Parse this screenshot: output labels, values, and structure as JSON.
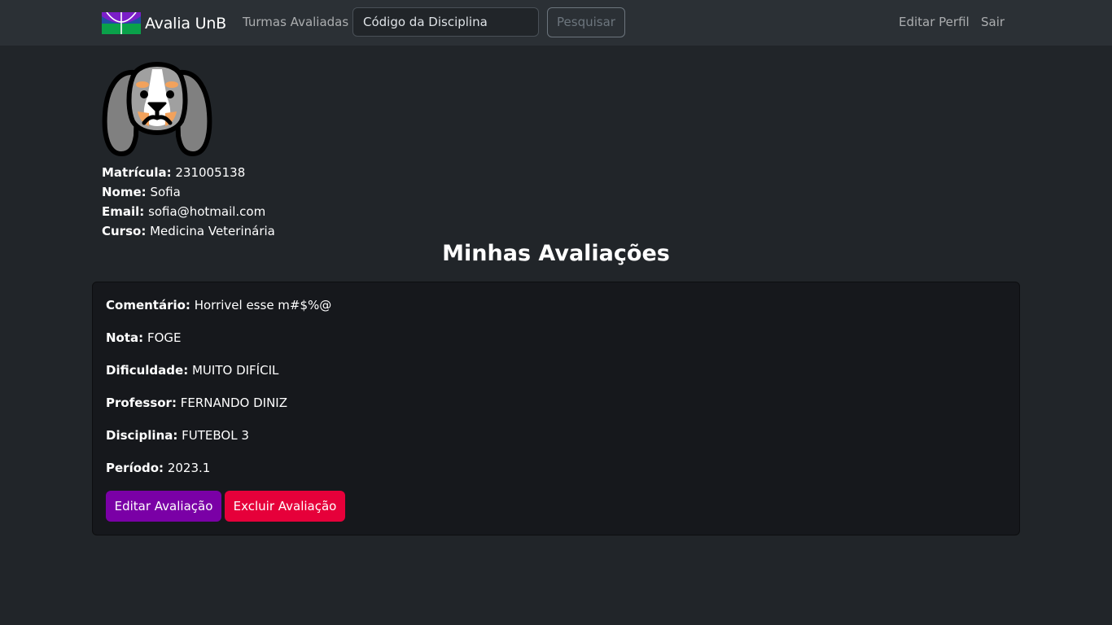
{
  "navbar": {
    "brand": "Avalia UnB",
    "turmas_link": "Turmas Avaliadas",
    "search_placeholder": "Código da Disciplina",
    "search_button": "Pesquisar",
    "edit_profile": "Editar Perfil",
    "logout": "Sair"
  },
  "profile": {
    "matricula_label": "Matrícula:",
    "matricula": "231005138",
    "nome_label": "Nome:",
    "nome": "Sofia",
    "email_label": "Email:",
    "email": "sofia@hotmail.com",
    "curso_label": "Curso:",
    "curso": "Medicina Veterinária"
  },
  "section_title": "Minhas Avaliações",
  "review": {
    "comentario_label": "Comentário:",
    "comentario": "Horrivel esse m#$%@",
    "nota_label": "Nota:",
    "nota": "FOGE",
    "dificuldade_label": "Dificuldade:",
    "dificuldade": "MUITO DIFÍCIL",
    "professor_label": "Professor:",
    "professor": "FERNANDO DINIZ",
    "disciplina_label": "Disciplina:",
    "disciplina": "FUTEBOL 3",
    "periodo_label": "Período:",
    "periodo": "2023.1",
    "edit_button": "Editar Avaliação",
    "delete_button": "Excluir Avaliação"
  },
  "icons": {
    "brand_logo": "unb-logo-icon",
    "avatar": "dog-avatar-icon"
  },
  "colors": {
    "background": "#212529",
    "navbar": "#2b3035",
    "card": "#16181c",
    "edit_button": "#7a00a6",
    "delete_button": "#e6003a"
  }
}
